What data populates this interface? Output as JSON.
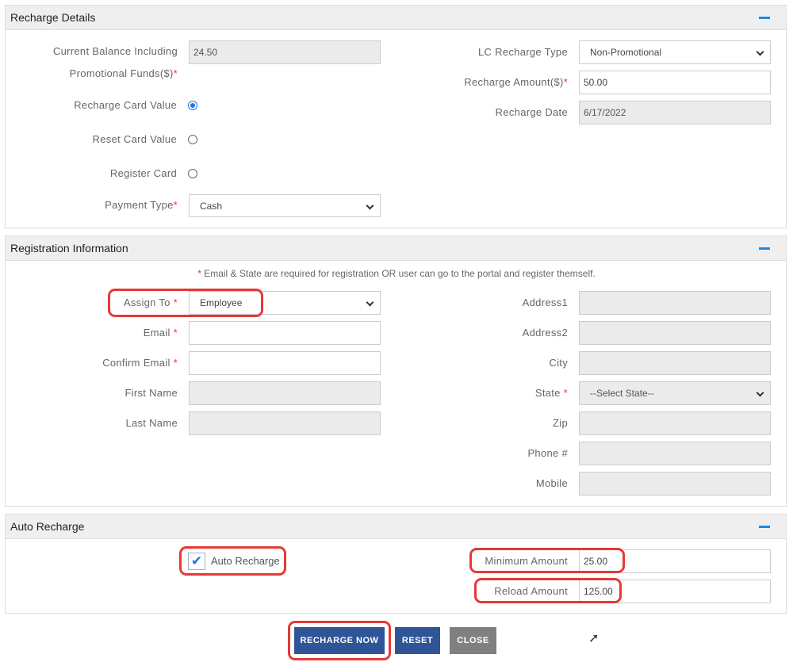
{
  "recharge_details": {
    "title": "Recharge Details",
    "balance_label_1": "Current Balance Including",
    "balance_label_2": "Promotional Funds($)",
    "balance_value": "24.50",
    "recharge_card_value": "Recharge Card Value",
    "reset_card_value": "Reset Card Value",
    "register_card": "Register Card",
    "payment_type_label": "Payment Type",
    "payment_type_value": "Cash",
    "lc_type_label": "LC Recharge Type",
    "lc_type_value": "Non-Promotional",
    "amount_label": "Recharge Amount($)",
    "amount_value": "50.00",
    "date_label": "Recharge Date",
    "date_value": "6/17/2022",
    "required_mark": "*"
  },
  "registration": {
    "title": "Registration Information",
    "note_star": "*",
    "note": " Email & State are required for registration OR user can go to the portal and register themself.",
    "assign_to_label": "Assign To",
    "assign_to_value": "Employee",
    "email_label": "Email",
    "confirm_email_label": "Confirm Email",
    "first_name_label": "First Name",
    "last_name_label": "Last Name",
    "address1_label": "Address1",
    "address2_label": "Address2",
    "city_label": "City",
    "state_label": "State",
    "state_value": "--Select State--",
    "zip_label": "Zip",
    "phone_label": "Phone #",
    "mobile_label": "Mobile"
  },
  "auto_recharge": {
    "title": "Auto Recharge",
    "checkbox_label": "Auto Recharge",
    "min_label": "Minimum Amount",
    "min_value": "25.00",
    "reload_label": "Reload Amount",
    "reload_value": "125.00"
  },
  "buttons": {
    "recharge": "RECHARGE NOW",
    "reset": "RESET",
    "close": "CLOSE"
  },
  "colors": {
    "primary": "#2f5597",
    "close": "#808080",
    "accent": "#1e88e5",
    "annotation": "#e53935"
  }
}
